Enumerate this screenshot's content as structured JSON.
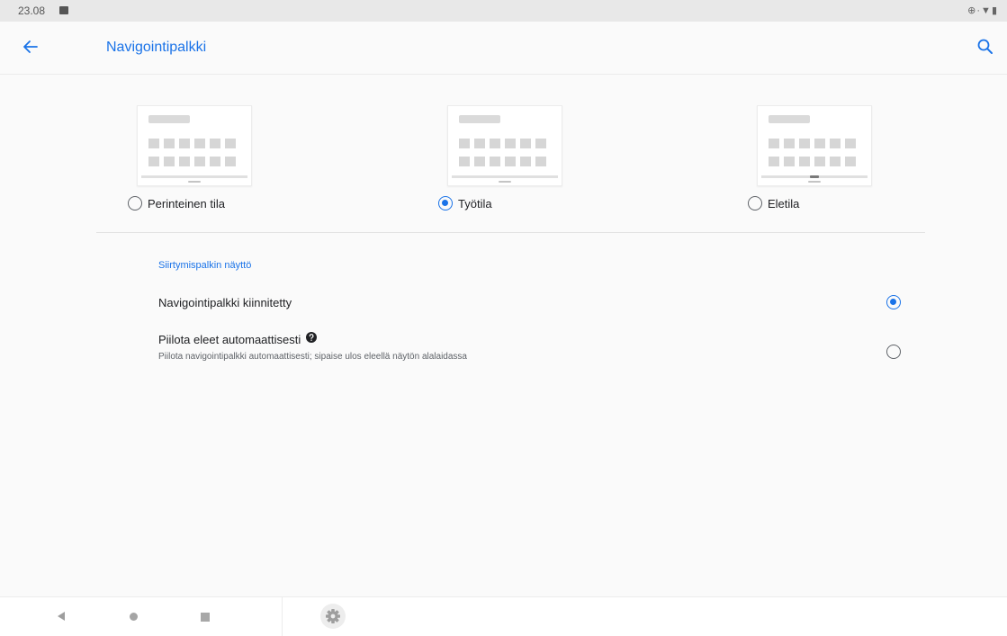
{
  "status_bar": {
    "time": "23.08",
    "right_icons": "⊕·▼▮"
  },
  "app_bar": {
    "title": "Navigointipalkki"
  },
  "modes": [
    {
      "label": "Perinteinen tila",
      "selected": false
    },
    {
      "label": "Työtila",
      "selected": true
    },
    {
      "label": "Eletila",
      "selected": false
    }
  ],
  "section": {
    "title": "Siirtymispalkin näyttö"
  },
  "preferences": [
    {
      "title": "Navigointipalkki kiinnitetty",
      "selected": true
    },
    {
      "title": "Piilota eleet automaattisesti",
      "subtitle": "Piilota navigointipalkki automaattisesti; sipaise ulos eleellä näytön alalaidassa",
      "selected": false
    }
  ],
  "colors": {
    "accent": "#1a73e8",
    "background": "#fafafa",
    "status_bar": "#e8e8e8"
  },
  "icons": {
    "back": "arrow-left-icon",
    "search": "search-icon",
    "help": "help-circle-icon",
    "nav_back": "triangle-left-icon",
    "nav_home": "circle-icon",
    "nav_recent": "square-icon",
    "nav_settings": "gear-icon"
  }
}
